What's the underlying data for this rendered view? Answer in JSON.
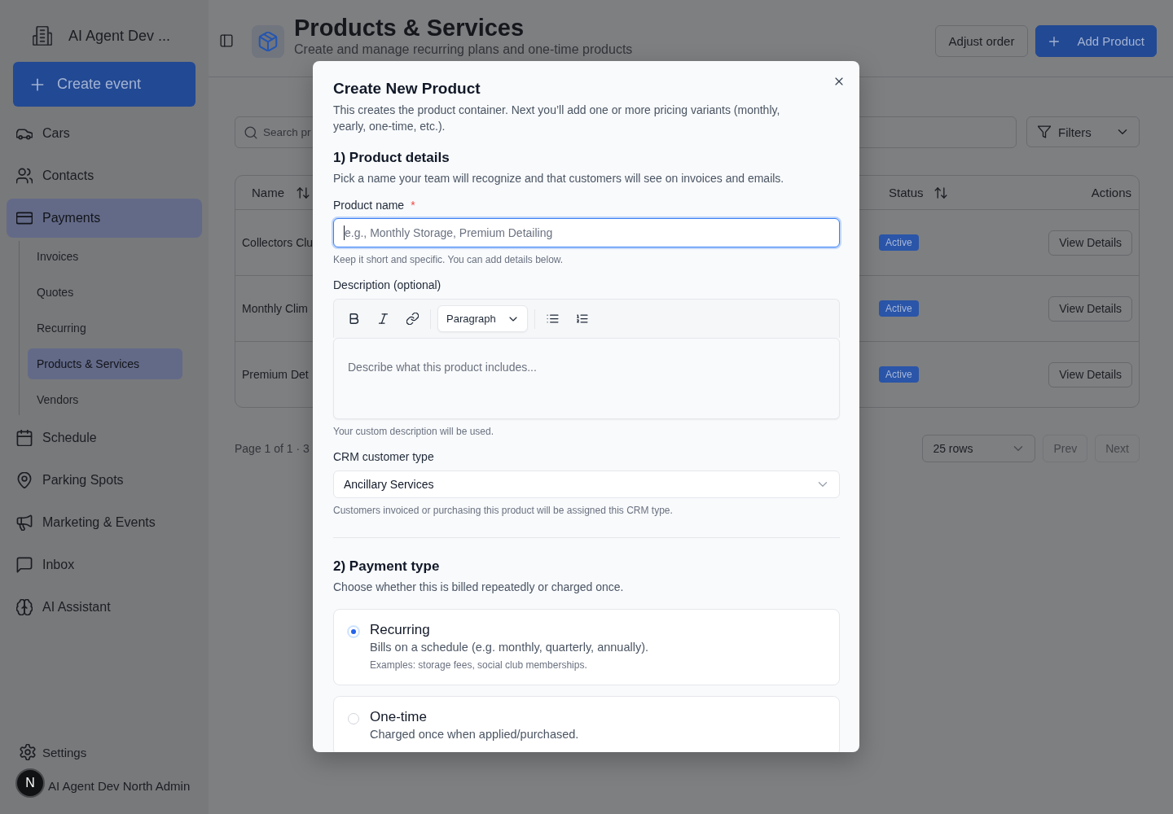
{
  "sidebar": {
    "brand": "AI Agent Dev ...",
    "create_button": "Create event",
    "items": [
      {
        "label": "Cars",
        "selected": false
      },
      {
        "label": "Contacts",
        "selected": false
      },
      {
        "label": "Payments",
        "selected": true,
        "children": [
          {
            "label": "Invoices",
            "selected": false
          },
          {
            "label": "Quotes",
            "selected": false
          },
          {
            "label": "Recurring",
            "selected": false
          },
          {
            "label": "Products & Services",
            "selected": true
          },
          {
            "label": "Vendors",
            "selected": false
          }
        ]
      },
      {
        "label": "Schedule",
        "selected": false
      },
      {
        "label": "Parking Spots",
        "selected": false
      },
      {
        "label": "Marketing & Events",
        "selected": false
      },
      {
        "label": "Inbox",
        "selected": false
      },
      {
        "label": "AI Assistant",
        "selected": false
      }
    ],
    "settings": "Settings",
    "user": {
      "initial": "N",
      "name": "AI Agent Dev North Admin"
    }
  },
  "header": {
    "title": "Products & Services",
    "subtitle": "Create and manage recurring plans and one-time products",
    "buttons": [
      {
        "label": "Adjust order",
        "kind": "secondary"
      },
      {
        "label": "Add Product",
        "kind": "primary"
      }
    ]
  },
  "toolbar": {
    "search": {
      "placeholder": "Search pr"
    },
    "filter_button": "Filters"
  },
  "table": {
    "columns": [
      {
        "label": "Name",
        "sortable": true
      },
      {
        "label": "Status",
        "sortable": true
      },
      {
        "label": "Actions",
        "sortable": false
      }
    ],
    "rows": [
      {
        "name": "Collectors Clu",
        "status": "Active",
        "action": "View Details"
      },
      {
        "name": "Monthly Clim",
        "status": "Active",
        "action": "View Details"
      },
      {
        "name": "Premium Det",
        "status": "Active",
        "action": "View Details"
      }
    ]
  },
  "pagination": {
    "summary": "Page 1 of 1 · 3",
    "page_size": "25 rows",
    "buttons": [
      {
        "label": "Prev",
        "disabled": true
      },
      {
        "label": "Next",
        "disabled": true
      }
    ]
  },
  "dialog": {
    "title": "Create New Product",
    "description": "This creates the product container. Next you’ll add one or more pricing variants (monthly, yearly, one-time, etc.).",
    "product_details": {
      "heading": "1) Product details",
      "description": "Pick a name your team will recognize and that customers will see on invoices and emails.",
      "name_field": {
        "label": "Product name",
        "required_mark": "*",
        "placeholder": "e.g., Monthly Storage, Premium Detailing",
        "focused": true,
        "hint": "Keep it short and specific. You can add details below."
      },
      "description_field": {
        "label": "Description (optional)",
        "block_format": "Paragraph",
        "placeholder": "Describe what this product includes...",
        "hint": "Your custom description will be used."
      },
      "crm_field": {
        "label": "CRM customer type",
        "value": "Ancillary Services",
        "hint": "Customers invoiced or purchasing this product will be assigned this CRM type."
      }
    },
    "payment_type": {
      "heading": "2) Payment type",
      "description": "Choose whether this is billed repeatedly or charged once.",
      "options": [
        {
          "title": "Recurring",
          "description": "Bills on a schedule (e.g. monthly, quarterly, annually).",
          "example": "Examples: storage fees, social club memberships.",
          "selected": true
        },
        {
          "title": "One-time",
          "description": "Charged once when applied/purchased.",
          "selected": false
        }
      ]
    }
  }
}
